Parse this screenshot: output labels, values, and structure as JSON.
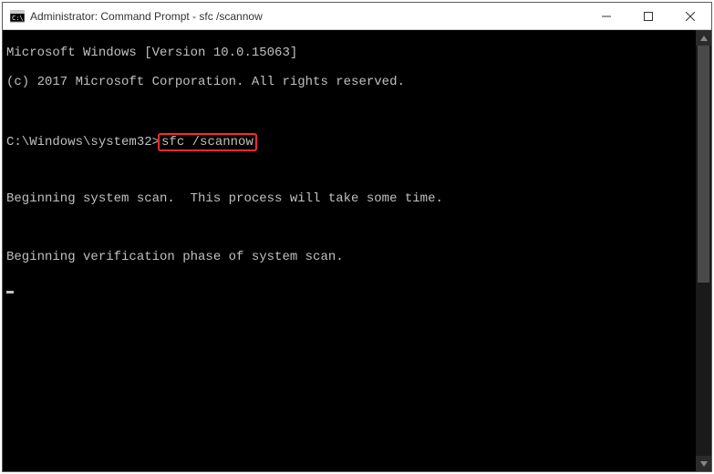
{
  "titlebar": {
    "title": "Administrator: Command Prompt - sfc  /scannow"
  },
  "terminal": {
    "line1": "Microsoft Windows [Version 10.0.15063]",
    "line2": "(c) 2017 Microsoft Corporation. All rights reserved.",
    "prompt": "C:\\Windows\\system32>",
    "command": "sfc /scannow",
    "line4": "Beginning system scan.  This process will take some time.",
    "line5": "Beginning verification phase of system scan."
  }
}
